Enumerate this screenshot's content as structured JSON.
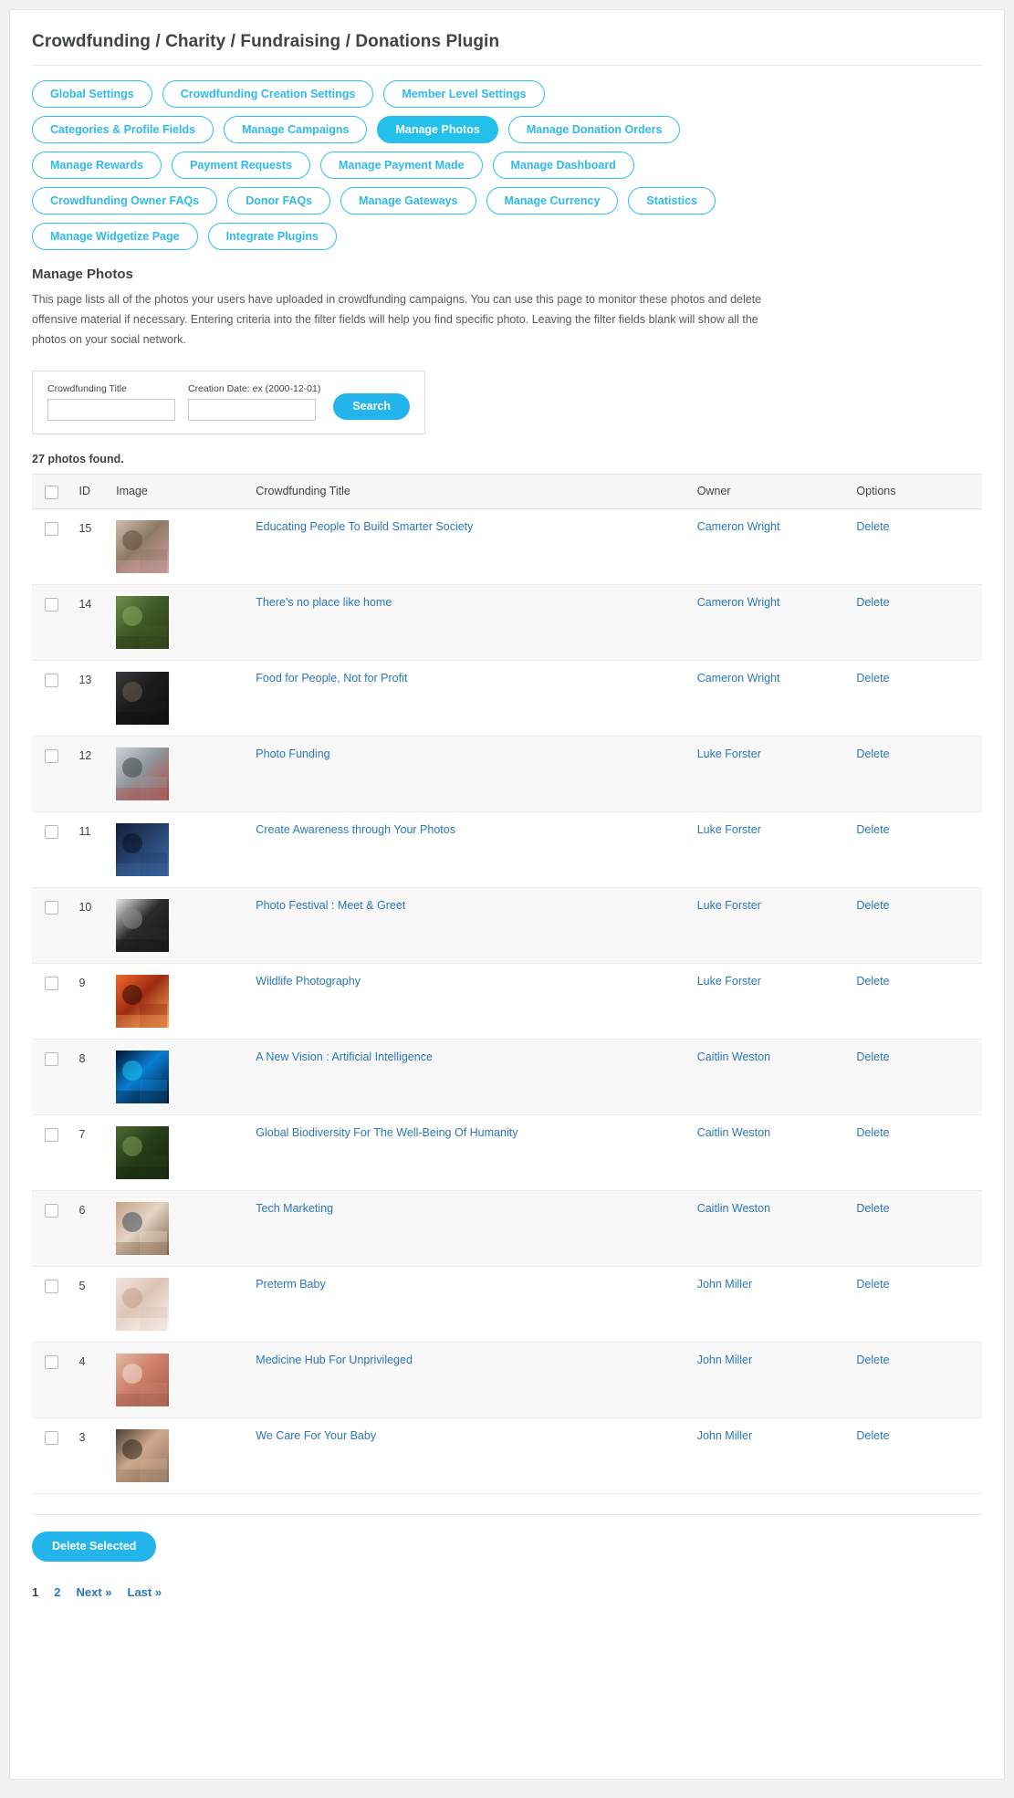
{
  "header": {
    "plugin_title": "Crowdfunding / Charity / Fundraising / Donations Plugin"
  },
  "tabs": [
    {
      "label": "Global Settings",
      "active": false
    },
    {
      "label": "Crowdfunding Creation Settings",
      "active": false
    },
    {
      "label": "Member Level Settings",
      "active": false
    },
    {
      "label": "Categories & Profile Fields",
      "active": false
    },
    {
      "label": "Manage Campaigns",
      "active": false
    },
    {
      "label": "Manage Photos",
      "active": true
    },
    {
      "label": "Manage Donation Orders",
      "active": false
    },
    {
      "label": "Manage Rewards",
      "active": false
    },
    {
      "label": "Payment Requests",
      "active": false
    },
    {
      "label": "Manage Payment Made",
      "active": false
    },
    {
      "label": "Manage Dashboard",
      "active": false
    },
    {
      "label": "Crowdfunding Owner FAQs",
      "active": false
    },
    {
      "label": "Donor FAQs",
      "active": false
    },
    {
      "label": "Manage Gateways",
      "active": false
    },
    {
      "label": "Manage Currency",
      "active": false
    },
    {
      "label": "Statistics",
      "active": false
    },
    {
      "label": "Manage Widgetize Page",
      "active": false
    },
    {
      "label": "Integrate Plugins",
      "active": false
    }
  ],
  "section": {
    "title": "Manage Photos",
    "description": "This page lists all of the photos your users have uploaded in crowdfunding campaigns. You can use this page to monitor these photos and delete offensive material if necessary. Entering criteria into the filter fields will help you find specific photo. Leaving the filter fields blank will show all the photos on your social network."
  },
  "filter": {
    "title_label": "Crowdfunding Title",
    "title_value": "",
    "title_placeholder": "",
    "date_label": "Creation Date: ex (2000-12-01)",
    "date_value": "",
    "date_placeholder": "",
    "search_label": "Search"
  },
  "results": {
    "count_text": "27 photos found."
  },
  "table": {
    "columns": {
      "id": "ID",
      "image": "Image",
      "title": "Crowdfunding Title",
      "owner": "Owner",
      "options": "Options"
    },
    "delete_label": "Delete",
    "rows": [
      {
        "id": "15",
        "title": "Educating People To Build Smarter Society",
        "owner": "Cameron Wright",
        "delete": "Delete",
        "thumb": "crowd-audience",
        "tall": true
      },
      {
        "id": "14",
        "title": "There's no place like home",
        "owner": "Cameron Wright",
        "delete": "Delete",
        "thumb": "green-forest-house",
        "tall": true
      },
      {
        "id": "13",
        "title": "Food for People, Not for Profit",
        "owner": "Cameron Wright",
        "delete": "Delete",
        "thumb": "dark-person",
        "tall": true
      },
      {
        "id": "12",
        "title": "Photo Funding",
        "owner": "Luke Forster",
        "delete": "Delete",
        "thumb": "gallery-wall",
        "tall": true
      },
      {
        "id": "11",
        "title": "Create Awareness through Your Photos",
        "owner": "Luke Forster",
        "delete": "Delete",
        "thumb": "night-crowd",
        "tall": true
      },
      {
        "id": "10",
        "title": "Photo Festival : Meet & Greet",
        "owner": "Luke Forster",
        "delete": "Delete",
        "thumb": "bw-frames",
        "tall": true
      },
      {
        "id": "9",
        "title": "Wildlife Photography",
        "owner": "Luke Forster",
        "delete": "Delete",
        "thumb": "sunset-tree",
        "tall": true
      },
      {
        "id": "8",
        "title": "A New Vision : Artificial Intelligence",
        "owner": "Caitlin Weston",
        "delete": "Delete",
        "thumb": "ai-brain",
        "tall": true
      },
      {
        "id": "7",
        "title": "Global Biodiversity For The Well-Being Of Humanity",
        "owner": "Caitlin Weston",
        "delete": "Delete",
        "thumb": "forest-trees",
        "tall": true
      },
      {
        "id": "6",
        "title": "Tech Marketing",
        "owner": "Caitlin Weston",
        "delete": "Delete",
        "thumb": "laptop-desk",
        "tall": true
      },
      {
        "id": "5",
        "title": "Preterm Baby",
        "owner": "John Miller",
        "delete": "Delete",
        "thumb": "baby-sleep",
        "tall": true
      },
      {
        "id": "4",
        "title": "Medicine Hub For Unprivileged",
        "owner": "John Miller",
        "delete": "Delete",
        "thumb": "pills-hands",
        "tall": true
      },
      {
        "id": "3",
        "title": "We Care For Your Baby",
        "owner": "John Miller",
        "delete": "Delete",
        "thumb": "baby-hands",
        "tall": true
      }
    ]
  },
  "footer": {
    "delete_selected_label": "Delete Selected",
    "pagination": [
      {
        "label": "1",
        "current": true
      },
      {
        "label": "2",
        "current": false
      },
      {
        "label": "Next »",
        "current": false
      },
      {
        "label": "Last »",
        "current": false
      }
    ]
  },
  "colors": {
    "accent": "#23b4ec",
    "tab_border": "#2fc0ef",
    "link": "#2b76b9",
    "text": "#3f4447"
  }
}
